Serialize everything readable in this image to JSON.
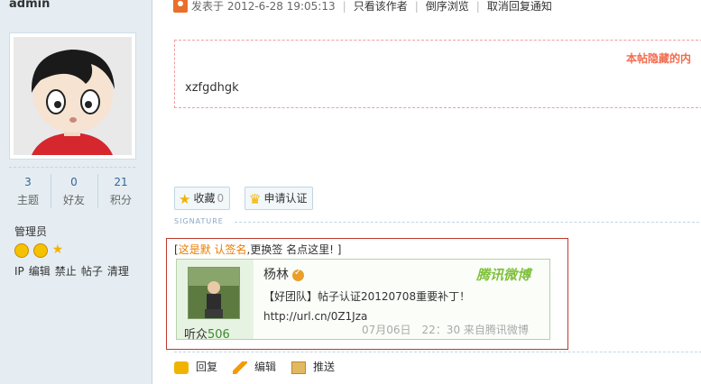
{
  "author": {
    "username": "admin",
    "stats": [
      {
        "value": "3",
        "label": "主题"
      },
      {
        "value": "0",
        "label": "好友"
      },
      {
        "value": "21",
        "label": "积分"
      }
    ],
    "group": "管理员",
    "admin_links": [
      "IP",
      "编辑",
      "禁止",
      "帖子",
      "清理"
    ]
  },
  "post": {
    "meta": {
      "posted": "发表于 2012-6-28 19:05:13",
      "only_author": "只看该作者",
      "reverse": "倒序浏览",
      "cancel_notify": "取消回复通知"
    },
    "hidden_notice": "本帖隐藏的内",
    "content": "xzfgdhgk",
    "buttons": {
      "favorite": "收藏",
      "favorite_count": "0",
      "apply_cert": "申请认证"
    },
    "signature_label": "SIGNATURE",
    "signature": {
      "prefix": "[",
      "highlight": "这是默 认签名",
      "rest": ",更换签 名点这里! ]"
    },
    "weibo": {
      "name": "杨林",
      "brand": "腾讯微博",
      "tweet": "【好团队】帖子认证20120708重要补丁！ http://url.cn/0Z1Jza",
      "time": "07月06日　22：30 来自腾讯微博",
      "fans_label": "听众",
      "fans_count": "506"
    },
    "actions": {
      "reply": "回复",
      "edit": "编辑",
      "push": "推送"
    }
  },
  "colors": {
    "sidebar_bg": "#e5edf2",
    "hidden_notice": "#f26c4f",
    "signature_border": "#c0392b",
    "weibo_brand": "#7fc13c"
  }
}
